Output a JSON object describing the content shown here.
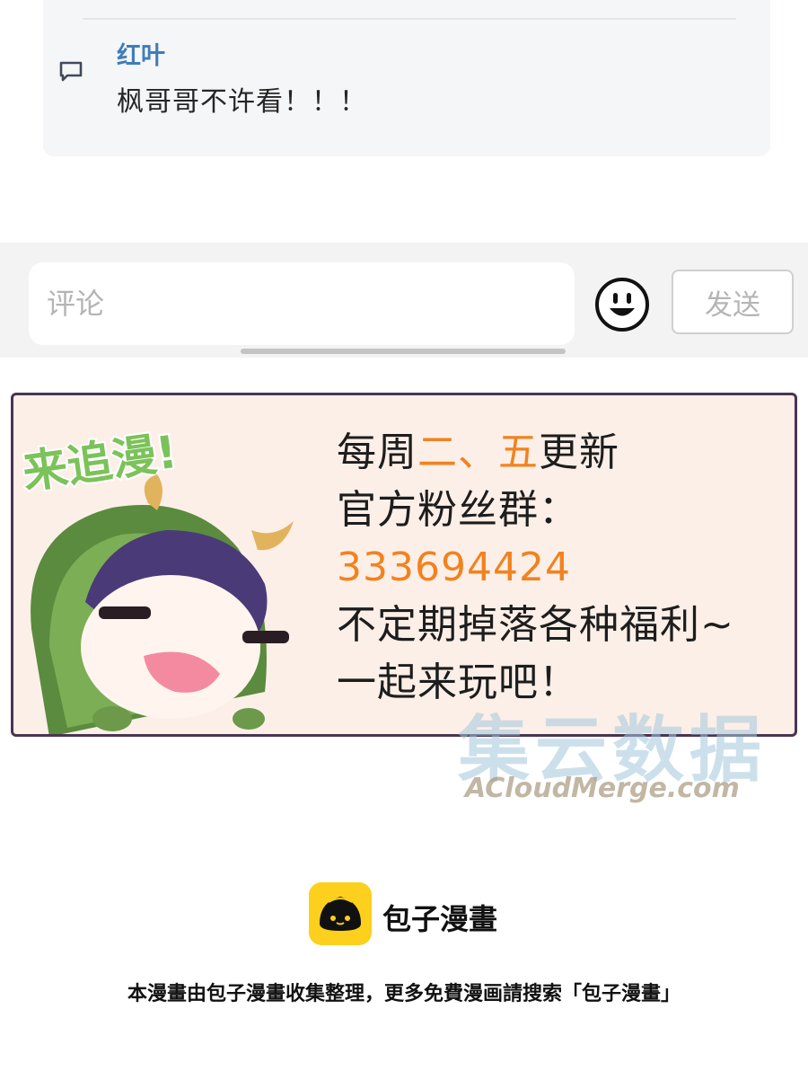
{
  "comment_thread": {
    "username": "红叶",
    "message": "枫哥哥不许看！！！",
    "icon": "comment-icon"
  },
  "comment_bar": {
    "placeholder": "评论",
    "emoji_icon": "smiley-icon",
    "send_label": "发送"
  },
  "banner": {
    "stamp": "来追漫!",
    "line1_a": "每周",
    "line1_hl1": "二",
    "line1_sep": "、",
    "line1_hl2": "五",
    "line1_b": "更新",
    "line2": "官方粉丝群：",
    "group_number": "333694424",
    "line4": "不定期掉落各种福利~",
    "line5": "一起来玩吧！",
    "highlight_color": "#f2821e"
  },
  "watermark": {
    "cn": "集云数据",
    "en": "ACloudMerge.com"
  },
  "footer": {
    "brand_name": "包子漫畫",
    "note": "本漫畫由包子漫畫收集整理，更多免費漫画請搜索「包子漫畫」",
    "logo_color": "#fcd01c"
  }
}
